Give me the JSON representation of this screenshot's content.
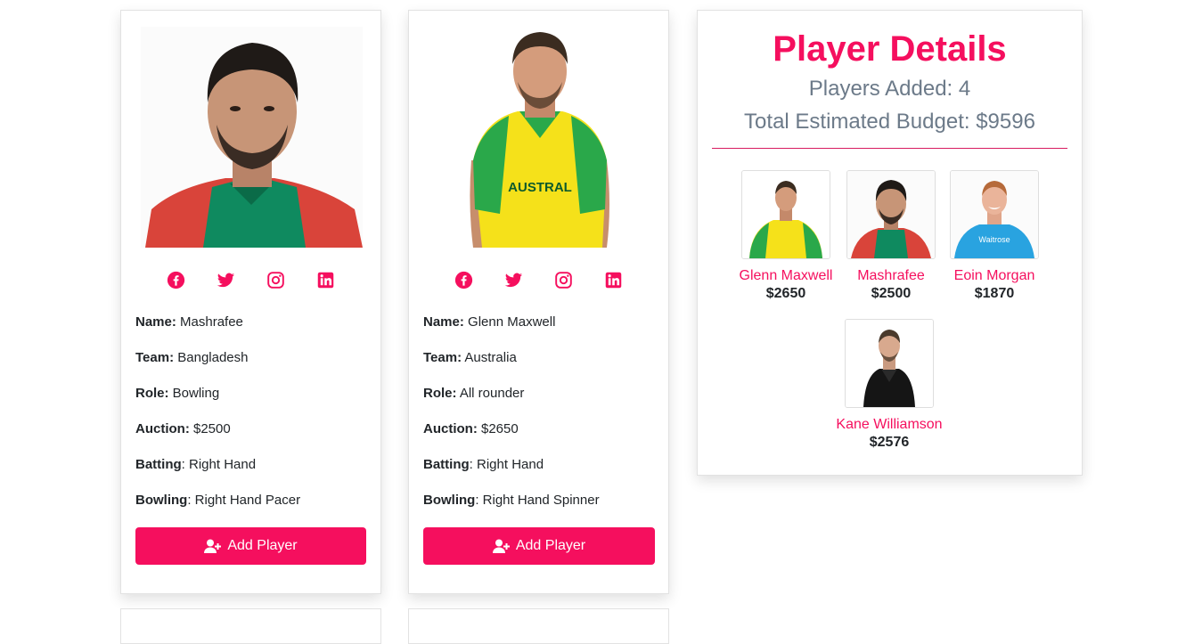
{
  "players": [
    {
      "name_label": "Name:",
      "name": "Mashrafee",
      "team_label": "Team:",
      "team": "Bangladesh",
      "role_label": "Role:",
      "role": "Bowling",
      "auction_label": "Auction:",
      "auction": "$2500",
      "batting_label": "Batting",
      "batting": ": Right Hand",
      "bowling_label": "Bowling",
      "bowling": ": Right Hand Pacer",
      "button_label": "Add Player",
      "jersey_color": "#0f8a5f"
    },
    {
      "name_label": "Name:",
      "name": "Glenn Maxwell",
      "team_label": "Team:",
      "team": "Australia",
      "role_label": "Role:",
      "role": "All rounder",
      "auction_label": "Auction:",
      "auction": "$2650",
      "batting_label": "Batting",
      "batting": ": Right Hand",
      "bowling_label": "Bowling",
      "bowling": ": Right Hand Spinner",
      "button_label": "Add Player",
      "jersey_color": "#f5e11a"
    }
  ],
  "socials": [
    "facebook-icon",
    "twitter-icon",
    "instagram-icon",
    "linkedin-icon"
  ],
  "details": {
    "title": "Player Details",
    "players_added": "Players Added: 4",
    "total_budget": "Total Estimated Budget: $9596",
    "selected": [
      {
        "name": "Glenn Maxwell",
        "price": "$2650"
      },
      {
        "name": "Mashrafee",
        "price": "$2500"
      },
      {
        "name": "Eoin Morgan",
        "price": "$1870"
      },
      {
        "name": "Kane Williamson",
        "price": "$2576"
      }
    ]
  },
  "colors": {
    "accent": "#f50f5e",
    "muted_text": "#6c7a89",
    "body_text": "#212529"
  }
}
